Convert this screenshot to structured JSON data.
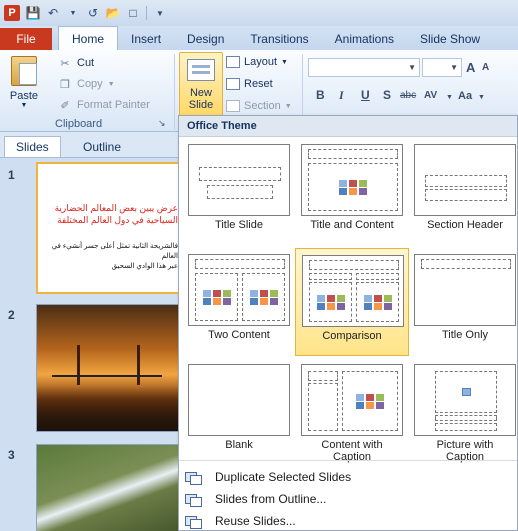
{
  "qat": {
    "app_logo": "P",
    "icons": [
      "save-icon",
      "undo-icon",
      "redo-icon",
      "open-icon",
      "new-icon",
      "customize-icon"
    ]
  },
  "tabs": [
    {
      "label": "File"
    },
    {
      "label": "Home"
    },
    {
      "label": "Insert"
    },
    {
      "label": "Design"
    },
    {
      "label": "Transitions"
    },
    {
      "label": "Animations"
    },
    {
      "label": "Slide Show"
    }
  ],
  "clipboard": {
    "paste": "Paste",
    "cut": "Cut",
    "copy": "Copy",
    "format_painter": "Format Painter",
    "group_label": "Clipboard"
  },
  "slides_group": {
    "new_slide": "New Slide",
    "layout": "Layout",
    "reset": "Reset",
    "section": "Section"
  },
  "font_group": {
    "bold": "B",
    "italic": "I",
    "underline": "U",
    "shadow": "S",
    "strikethrough": "abc",
    "spacing": "AV",
    "case": "Aa",
    "grow": "A",
    "shrink": "A"
  },
  "left_panel": {
    "tab_slides": "Slides",
    "tab_outline": "Outline",
    "slides": [
      {
        "number": "1",
        "title_line1": "عرض يبين بعض المعالم الحضارية",
        "title_line2": "السياحية في دول العالم المختلفة",
        "body_line1": "فالشريحة الثانية تمثل أعلى جسر أنشيء في العالم",
        "body_line2": "عبر هذا الوادي السحيق"
      },
      {
        "number": "2"
      },
      {
        "number": "3"
      }
    ]
  },
  "gallery": {
    "header": "Office Theme",
    "layouts": [
      {
        "name": "Title Slide"
      },
      {
        "name": "Title and Content"
      },
      {
        "name": "Section Header"
      },
      {
        "name": "Two Content"
      },
      {
        "name": "Comparison"
      },
      {
        "name": "Title Only"
      },
      {
        "name": "Blank"
      },
      {
        "name": "Content with Caption"
      },
      {
        "name": "Picture with Caption"
      }
    ],
    "selected": "Comparison",
    "menu": [
      {
        "label": "Duplicate Selected Slides"
      },
      {
        "label": "Slides from Outline..."
      },
      {
        "label": "Reuse Slides..."
      }
    ]
  },
  "colors": {
    "file_tab": "#c8391f",
    "selection": "#ffe48a",
    "ribbon": "#e3edf9"
  }
}
